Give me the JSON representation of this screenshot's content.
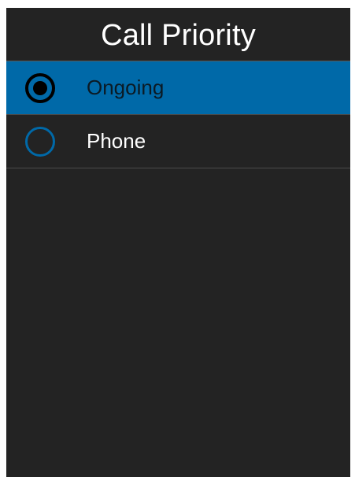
{
  "header": {
    "title": "Call Priority"
  },
  "options": [
    {
      "label": "Ongoing",
      "selected": true
    },
    {
      "label": "Phone",
      "selected": false
    }
  ],
  "colors": {
    "background": "#232323",
    "accent": "#0069a8",
    "text": "#ffffff"
  },
  "icons": {
    "selected": "radio-checked-icon",
    "unselected": "radio-unchecked-icon"
  }
}
